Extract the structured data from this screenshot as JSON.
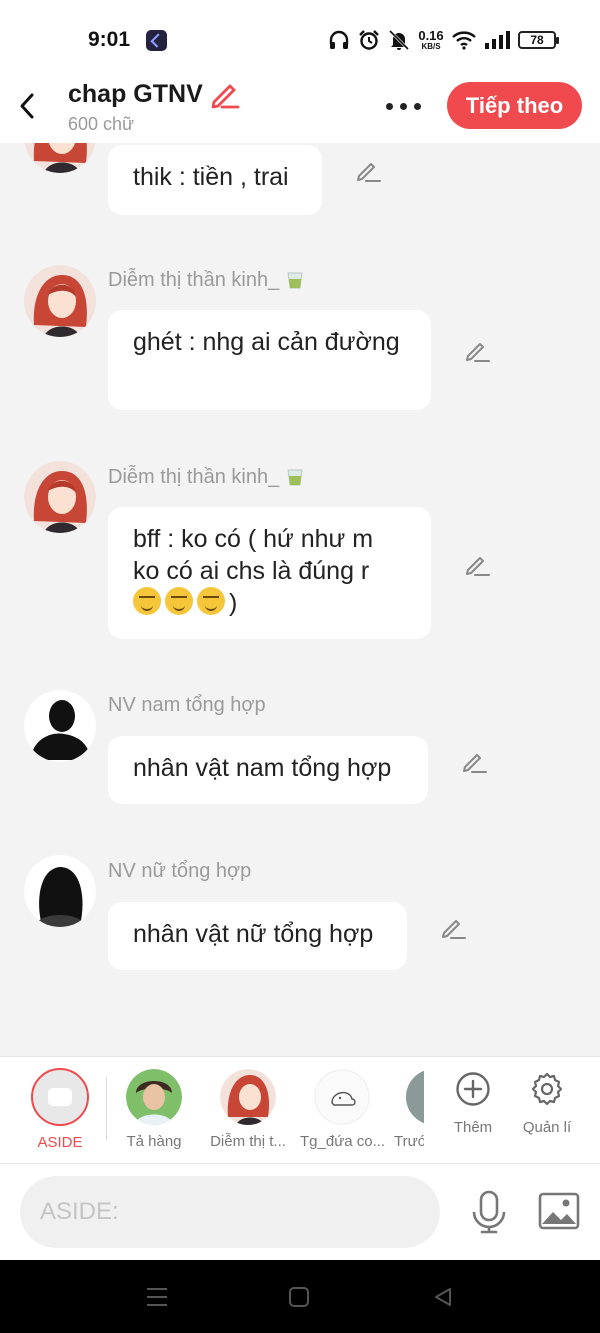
{
  "status_bar": {
    "time": "9:01",
    "net_speed_value": "0.16",
    "net_speed_unit": "KB/S",
    "battery": "78",
    "icons": [
      "app-icon",
      "headphones-icon",
      "alarm-icon",
      "mute-icon",
      "wifi-icon",
      "signal-icon",
      "battery-icon"
    ]
  },
  "header": {
    "title": "chap GTNV",
    "word_count": "600 chữ",
    "next_button": "Tiếp theo",
    "accent_color": "#f04a4f"
  },
  "messages": [
    {
      "speaker": "",
      "text": "thik : tiền , trai"
    },
    {
      "speaker": "Diễm thị thần kinh_",
      "text": "ghét : nhg ai cản đường"
    },
    {
      "speaker": "Diễm thị thần kinh_",
      "text": "bff : ko có ( hứ như m ko có ai chs là đúng r",
      "tail": ")"
    },
    {
      "speaker": "NV nam tổng hợp",
      "text": "nhân vật nam tổng hợp"
    },
    {
      "speaker": "NV nữ tổng hợp",
      "text": "nhân vật nữ tổng hợp"
    }
  ],
  "characters": [
    {
      "label": "ASIDE"
    },
    {
      "label": "Tả hàng"
    },
    {
      "label": "Diễm thị t..."
    },
    {
      "label": "Tg_đứa co..."
    },
    {
      "label": "Trướ"
    }
  ],
  "actions": {
    "add_label": "Thêm",
    "manage_label": "Quản lí"
  },
  "composer": {
    "placeholder": "ASIDE:"
  }
}
